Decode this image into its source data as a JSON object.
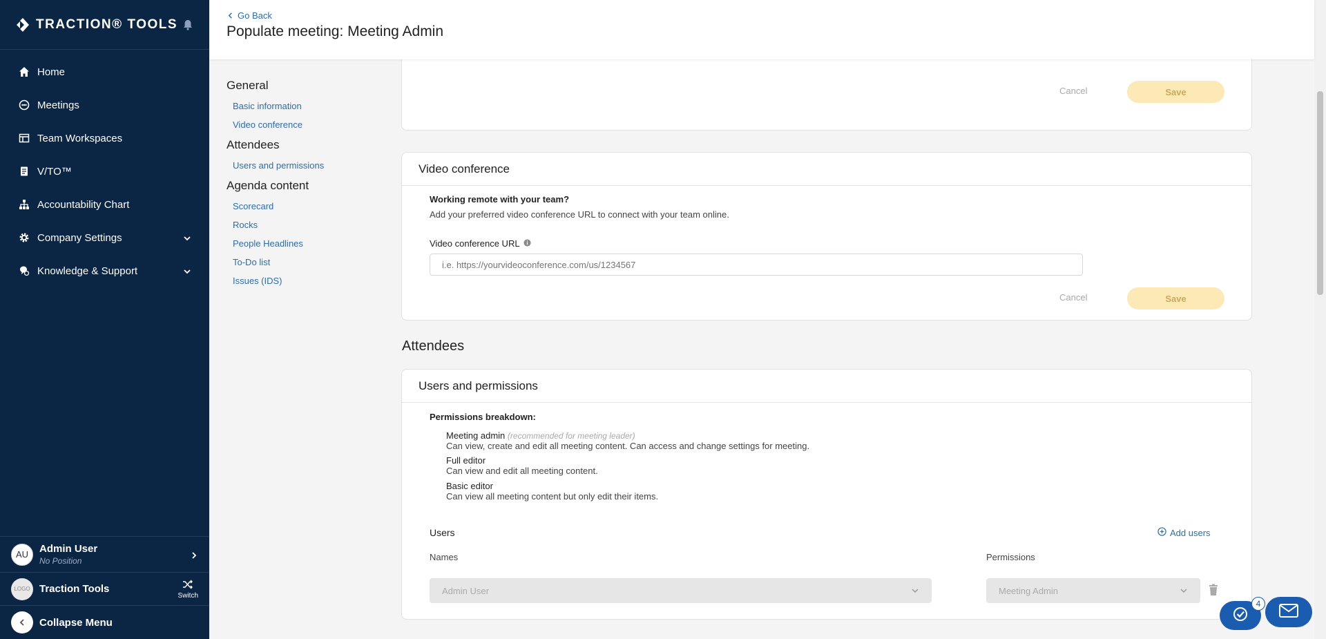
{
  "app": {
    "brand": "TRACTION® TOOLS"
  },
  "nav": {
    "items": [
      {
        "label": "Home",
        "icon": "home-icon"
      },
      {
        "label": "Meetings",
        "icon": "meetings-icon"
      },
      {
        "label": "Team Workspaces",
        "icon": "workspace-icon"
      },
      {
        "label": "V/TO™",
        "icon": "document-icon"
      },
      {
        "label": "Accountability Chart",
        "icon": "org-chart-icon"
      },
      {
        "label": "Company Settings",
        "icon": "gear-icon"
      },
      {
        "label": "Knowledge & Support",
        "icon": "support-icon"
      }
    ]
  },
  "user": {
    "initials": "AU",
    "name": "Admin User",
    "position": "No Position"
  },
  "org": {
    "logo_text": "LOGO",
    "name": "Traction Tools",
    "switch_label": "Switch"
  },
  "collapse_label": "Collapse Menu",
  "header": {
    "back_label": "Go Back",
    "title": "Populate meeting: Meeting Admin"
  },
  "subnav": {
    "general": "General",
    "general_links": [
      "Basic information",
      "Video conference"
    ],
    "attendees": "Attendees",
    "attendees_links": [
      "Users and permissions"
    ],
    "agenda": "Agenda content",
    "agenda_links": [
      "Scorecard",
      "Rocks",
      "People Headlines",
      "To-Do list",
      "Issues (IDS)"
    ]
  },
  "basic_card": {
    "cancel": "Cancel",
    "save": "Save"
  },
  "video_card": {
    "title": "Video conference",
    "heading": "Working remote with your team?",
    "description": "Add your preferred video conference URL to connect with your team online.",
    "url_label": "Video conference URL",
    "url_placeholder": "i.e. https://yourvideoconference.com/us/1234567",
    "cancel": "Cancel",
    "save": "Save"
  },
  "attendees_title": "Attendees",
  "users_card": {
    "title": "Users and permissions",
    "breakdown_label": "Permissions breakdown:",
    "perms": [
      {
        "name": "Meeting admin",
        "note": "(recommended for meeting leader)",
        "desc": "Can view, create and edit all meeting content. Can access and change settings for meeting."
      },
      {
        "name": "Full editor",
        "note": "",
        "desc": "Can view and edit all meeting content."
      },
      {
        "name": "Basic editor",
        "note": "",
        "desc": "Can view all meeting content but only edit their items."
      }
    ],
    "users_label": "Users",
    "add_users": "Add users",
    "names_header": "Names",
    "permissions_header": "Permissions",
    "row": {
      "name": "Admin User",
      "permission": "Meeting Admin"
    }
  },
  "widgets": {
    "tasks_badge": "4"
  }
}
